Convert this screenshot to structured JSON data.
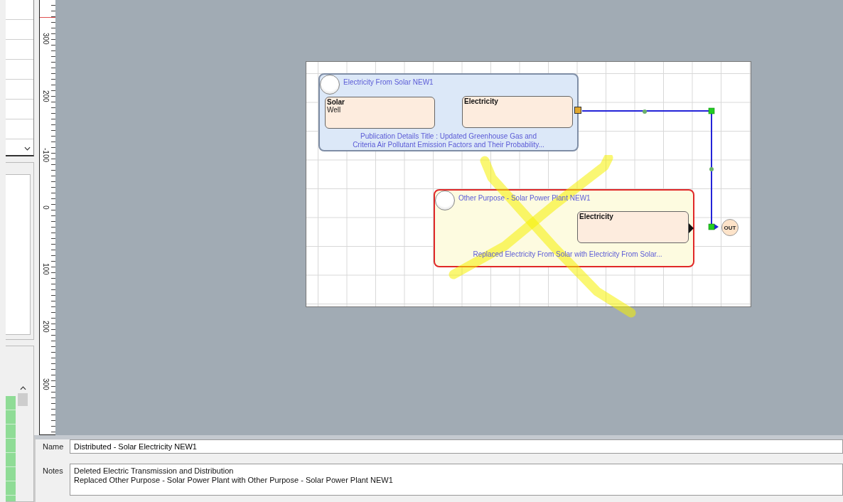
{
  "ruler": {
    "labels": [
      "300",
      "200",
      "-100",
      "0",
      "100",
      "200",
      "300"
    ]
  },
  "diagram": {
    "processes": [
      {
        "kind": "normal",
        "title": "Electricity From Solar NEW1",
        "boxes": [
          {
            "title": "Solar",
            "subtitle": "Well"
          },
          {
            "title": "Electricity"
          }
        ],
        "note": "Publication Details Title : Updated Greenhouse Gas and Criteria Air Pollutant Emission Factors and Their Probability..."
      },
      {
        "kind": "replaced",
        "title": "Other Purpose - Solar Power Plant NEW1",
        "boxes": [
          {
            "title": "Electricity"
          }
        ],
        "note": "Replaced Electricity From Solar with Electricity From Solar..."
      }
    ],
    "output": {
      "label": "OUT"
    },
    "annotation": {
      "kind": "cross"
    }
  },
  "properties": {
    "name_label": "Name",
    "name_value": "Distributed - Solar Electricity NEW1",
    "notes_label": "Notes",
    "notes_lines": [
      "Deleted Electric Transmission and Distribution",
      "Replaced Other Purpose - Solar Power Plant with Other Purpose - Solar Power Plant NEW1"
    ]
  }
}
